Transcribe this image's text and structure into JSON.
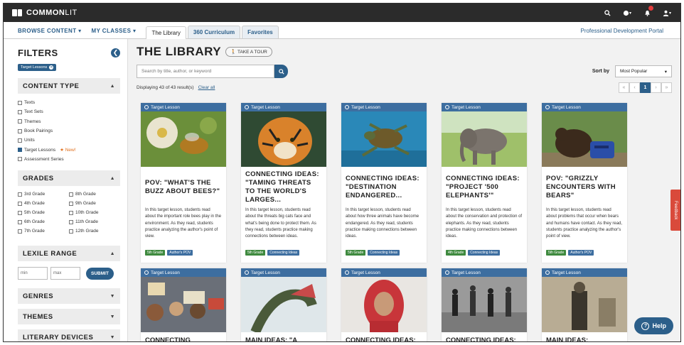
{
  "app": {
    "logo_text_bold": "COMMON",
    "logo_text_light": "LIT"
  },
  "nav": {
    "browse": "BROWSE CONTENT ▾",
    "classes": "MY CLASSES ▾",
    "tabs": [
      "The Library",
      "360 Curriculum",
      "Favorites"
    ],
    "portal": "Professional Development Portal"
  },
  "filters": {
    "title": "FILTERS",
    "active_chip": "Target Lessons",
    "content_type": {
      "heading": "CONTENT TYPE",
      "items": [
        "Texts",
        "Text Sets",
        "Themes",
        "Book Pairings",
        "Units",
        "Target Lessons",
        "Assessment Series"
      ],
      "new_label": "★ New!"
    },
    "grades": {
      "heading": "GRADES",
      "left": [
        "3rd Grade",
        "4th Grade",
        "5th Grade",
        "6th Grade",
        "7th Grade"
      ],
      "right": [
        "8th Grade",
        "9th Grade",
        "10th Grade",
        "11th Grade",
        "12th Grade"
      ]
    },
    "lexile": {
      "heading": "LEXILE RANGE",
      "min": "min",
      "max": "max",
      "submit": "SUBMIT"
    },
    "genres": "GENRES",
    "themes": "THEMES",
    "literary": "LITERARY DEVICES"
  },
  "library": {
    "title": "THE LIBRARY",
    "tour": "TAKE A TOUR",
    "search_placeholder": "Search by title, author, or keyword",
    "displaying": "Displaying 43 of 43 result(s)",
    "clear": "Clear all",
    "sort_label": "Sort by",
    "sort_value": "Most Popular",
    "page": "1",
    "band_label": "Target Lesson",
    "cards_top": [
      {
        "title": "POV: \"WHAT'S THE BUZZ ABOUT BEES?\"",
        "desc": "In this target lesson, students read about the important role bees play in the environment. As they read, students practice analyzing the author's point of view.",
        "grade": "5th Grade",
        "topic": "Author's POV",
        "img": "bee"
      },
      {
        "title": "CONNECTING IDEAS: \"TAMING THREATS TO THE WORLD'S LARGES...",
        "desc": "In this target lesson, students read about the threats big cats face and what's being done to protect them. As they read, students practice making connections between ideas.",
        "grade": "5th Grade",
        "topic": "Connecting Ideas",
        "img": "tiger"
      },
      {
        "title": "CONNECTING IDEAS: \"DESTINATION ENDANGERED...",
        "desc": "In this target lesson, students read about how three animals have become endangered. As they read, students practice making connections between ideas.",
        "grade": "5th Grade",
        "topic": "Connecting Ideas",
        "img": "turtle"
      },
      {
        "title": "CONNECTING IDEAS: \"PROJECT '500 ELEPHANTS'\"",
        "desc": "In this target lesson, students read about the conservation and protection of elephants. As they read, students practice making connections between ideas.",
        "grade": "4th Grade",
        "topic": "Connecting Ideas",
        "img": "elephant"
      },
      {
        "title": "POV: \"GRIZZLY ENCOUNTERS WITH BEARS\"",
        "desc": "In this target lesson, students read about problems that occur when bears and humans have contact. As they read, students practice analyzing the author's point of view.",
        "grade": "5th Grade",
        "topic": "Author's POV",
        "img": "bear"
      }
    ],
    "cards_bottom": [
      {
        "title": "CONNECTING",
        "img": "protest"
      },
      {
        "title": "MAIN IDEAS: \"A",
        "img": "snake"
      },
      {
        "title": "CONNECTING IDEAS: \"MALALA",
        "img": "malala"
      },
      {
        "title": "CONNECTING IDEAS: \"FIRST",
        "img": "bw"
      },
      {
        "title": "MAIN IDEAS:",
        "img": "sepia"
      }
    ]
  },
  "feedback": "Feedback",
  "help": "Help"
}
